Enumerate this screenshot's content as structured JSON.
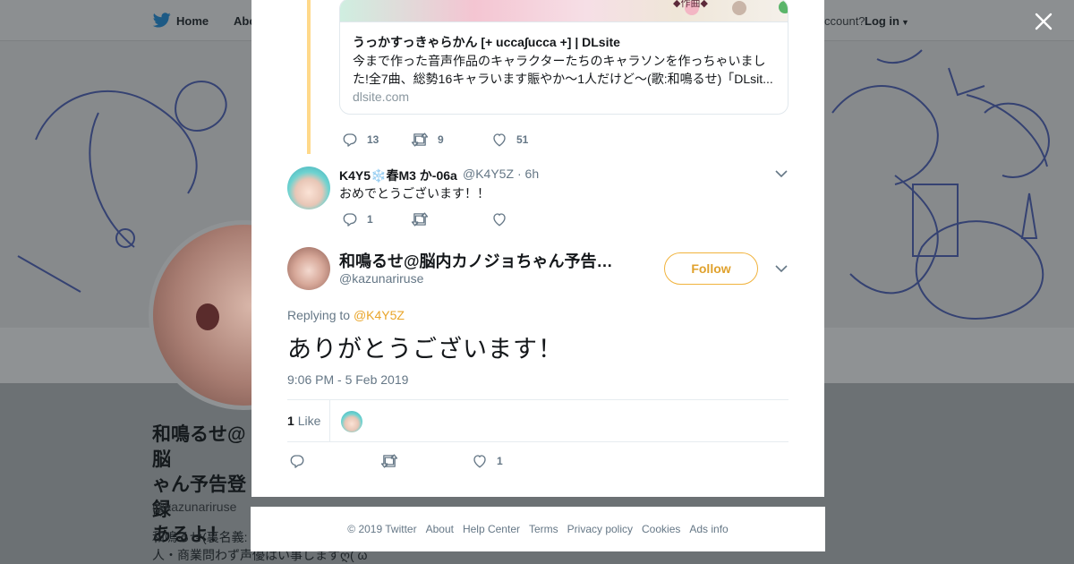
{
  "background": {
    "nav": {
      "home_label": "Home",
      "about_label": "Abo",
      "account_prompt": "ccount?",
      "login_label": "Log in"
    },
    "profile": {
      "name": "和鳴るせ@脳内カノジョちゃん予告登録あるよ！",
      "name_visible": "和鳴るせ@脳ゃん予告登録あるよ！",
      "name_line1": "和鳴るせ@脳",
      "name_line2": "ゃん予告登録",
      "name_line3": "あるよ！",
      "handle": "@kazunariruse",
      "bio_line1": "和鳴るせ(裏名義:",
      "bio_line2": "人・商業問わず声優はい事しますღ( ω"
    }
  },
  "thread": {
    "link_card": {
      "image_caption": "◆作曲◆",
      "title": "うっかすっきゃらかん [+ ucca∫ucca +] | DLsite",
      "description": "今まで作った音声作品のキャラクターたちのキャラソンを作っちゃいました!全7曲、総勢16キャラいます賑やか～1人だけど～(歌:和鳴るせ)「DLsit...",
      "domain": "dlsite.com"
    },
    "parent_actions": {
      "replies": "13",
      "retweets": "9",
      "likes": "51"
    },
    "reply": {
      "display_name": "K4Y5❄️春M3 か-06a",
      "handle": "@K4Y5Z",
      "time": "· 6h",
      "text": "おめでとうございます！！",
      "replies": "1",
      "retweets": "",
      "likes": ""
    }
  },
  "focused_tweet": {
    "display_name": "和鳴るせ@脳内カノジョちゃん予告…",
    "handle": "@kazunariruse",
    "follow_label": "Follow",
    "replying_prefix": "Replying to ",
    "replying_to": "@K4Y5Z",
    "text": "ありがとうございます！",
    "timestamp": "9:06 PM - 5 Feb 2019",
    "like_count": "1",
    "like_word": "Like",
    "actions": {
      "replies": "",
      "retweets": "",
      "likes": "1"
    }
  },
  "footer": {
    "copyright": "© 2019 Twitter",
    "links": [
      "About",
      "Help Center",
      "Terms",
      "Privacy policy",
      "Cookies",
      "Ads info"
    ]
  },
  "colors": {
    "accent": "#e9a52a",
    "thread_line": "#ffd98a",
    "muted_text": "#657786",
    "overlay": "#6a6f73"
  },
  "icons": [
    "twitter-bird-icon",
    "caret-down-icon",
    "close-icon",
    "reply-icon",
    "retweet-icon",
    "heart-icon",
    "chevron-down-icon"
  ]
}
